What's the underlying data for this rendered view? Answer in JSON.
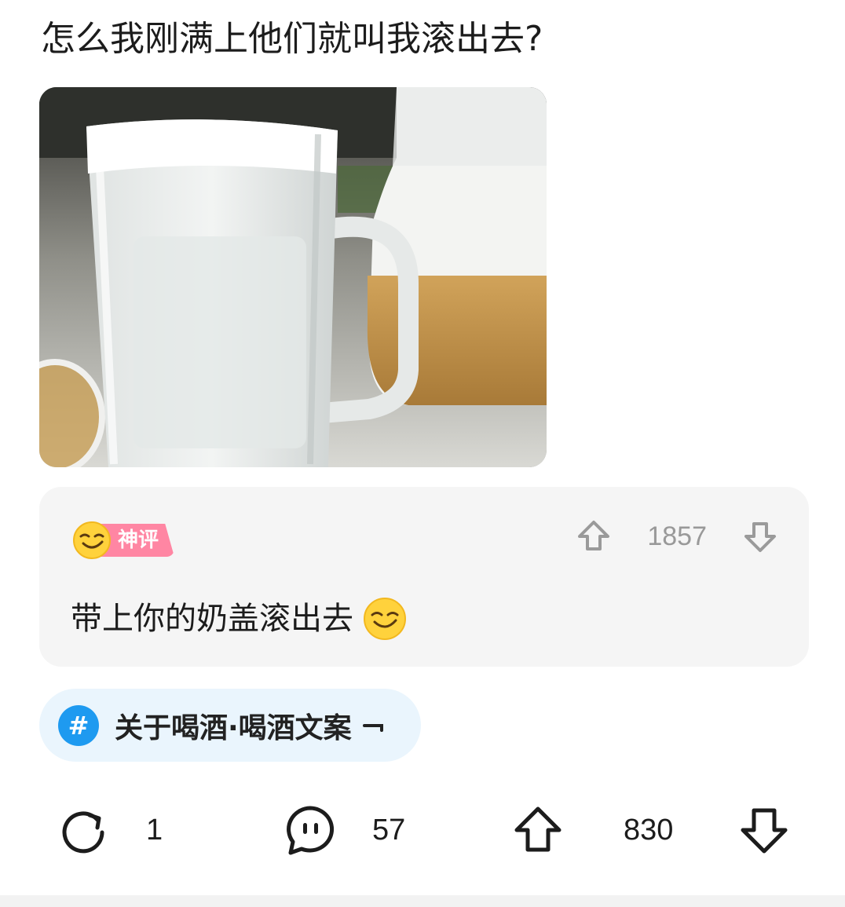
{
  "post": {
    "title": "怎么我刚满上他们就叫我滚出去?"
  },
  "top_comment": {
    "badge_label": "神评",
    "vote_count": "1857",
    "text": "带上你的奶盖滚出去"
  },
  "topic": {
    "label": "关于喝酒·喝酒文案",
    "hash_symbol": "#"
  },
  "actions": {
    "share_count": "1",
    "comment_count": "57",
    "upvote_count": "830"
  },
  "colors": {
    "badge_pink": "#ff86a3",
    "topic_blue": "#1e9af0",
    "topic_bg": "#eaf5fd",
    "card_bg": "#f5f5f5"
  }
}
